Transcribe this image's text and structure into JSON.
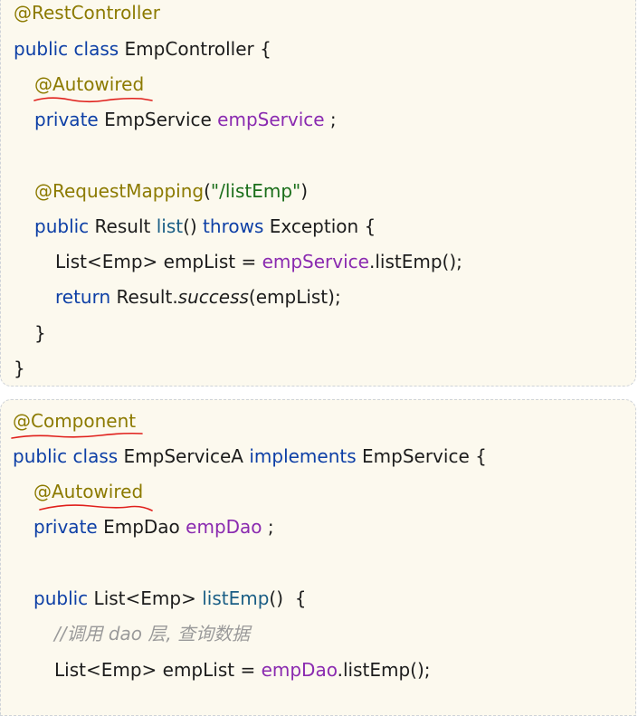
{
  "block1": {
    "line1": {
      "annotation": "@RestController"
    },
    "line2": {
      "kw": "public class ",
      "name": "EmpController",
      "brace": " {"
    },
    "line3": {
      "annotation": "@Autowired"
    },
    "line4": {
      "kw": "private ",
      "type": "EmpService ",
      "field": "empService",
      "semi": " ;"
    },
    "line5": {
      "annotation": "@RequestMapping",
      "open": "(",
      "string": "\"/listEmp\"",
      "close": ")"
    },
    "line6": {
      "kw": "public ",
      "type": "Result ",
      "method": "list",
      "parens": "() ",
      "throws": "throws",
      "exc": " Exception {"
    },
    "line7": {
      "pre": "List<Emp> empList = ",
      "field": "empService",
      "post": ".listEmp();"
    },
    "line8": {
      "kw": "return ",
      "pre": "Result.",
      "italic": "success",
      "post": "(empList);"
    },
    "line9": {
      "text": "}"
    },
    "line10": {
      "text": "}"
    }
  },
  "block2": {
    "line1": {
      "annotation": "@Component"
    },
    "line2": {
      "kw": "public class ",
      "name": "EmpServiceA ",
      "kw2": "implements",
      "iface": " EmpService {"
    },
    "line3": {
      "annotation": "@Autowired"
    },
    "line4": {
      "kw": "private ",
      "type": "EmpDao ",
      "field": "empDao",
      "semi": " ;"
    },
    "line5": {
      "kw": "public ",
      "type": "List<Emp> ",
      "method": "listEmp",
      "post": "()  {"
    },
    "line6": {
      "comment": "//调用 dao 层, 查询数据"
    },
    "line7": {
      "pre": "List<Emp> empList = ",
      "field": "empDao",
      "post": ".listEmp();"
    }
  },
  "colors": {
    "background": "#fcf9ee",
    "annotation": "#8c7a00",
    "keyword": "#0d3fa6",
    "field": "#8a2ab0",
    "method": "#1a5e85",
    "string": "#1a6e1a",
    "comment": "#9a9a9a",
    "squiggle": "#e0201c"
  }
}
